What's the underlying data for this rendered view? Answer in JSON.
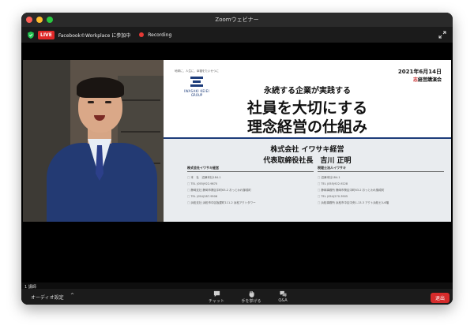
{
  "window": {
    "title": "Zoomウェビナー"
  },
  "infobar": {
    "live_label": "LIVE",
    "stream_text": "Facebook©Workplace に参加中",
    "recording_label": "Recording"
  },
  "slide": {
    "logo_tagline": "地球に、人生に、幸福をたいせつに",
    "logo_name": "IWASAKI KEIEI",
    "logo_group": "GROUP",
    "date": "2021年6月14日",
    "lecture_red": "志",
    "lecture_rest": "経営講演会",
    "subtitle": "永続する企業が実践する",
    "title_line1": "社員を大切にする",
    "title_line2": "理念経営の仕組み",
    "company": "株式会社 イワサキ経営",
    "ceo": "代表取締役社長　吉川 正明",
    "left_col": {
      "heading": "株式会社イワサキ経営",
      "rows": [
        "本　社　沼津本社184-1",
        "TEL (055)922-9870",
        "静岡支社 静岡市葵区中町63-2 おっとわれ御成町",
        "TEL (054)287-9506",
        "浜松支社 浜松市中区板屋町111-2 浜松アクトタワー"
      ]
    },
    "right_col": {
      "heading": "税理士法人イワサキ",
      "rows": [
        "沼津本社184-1",
        "TEL (055)922-9228",
        "静岡事務所 静岡市葵区中町63-2 おっとわれ御成町",
        "TEL (054)270-3905",
        "浜松事務所 浜松市中区中央1-13-3 アクト浜松ビル6階"
      ]
    }
  },
  "video": {
    "speaker_label": "1 講師"
  },
  "toolbar": {
    "audio_label": "オーディオ設定",
    "chat_label": "チャット",
    "raise_hand_label": "手を挙げる",
    "qa_label": "Q&A",
    "leave_label": "退出"
  }
}
